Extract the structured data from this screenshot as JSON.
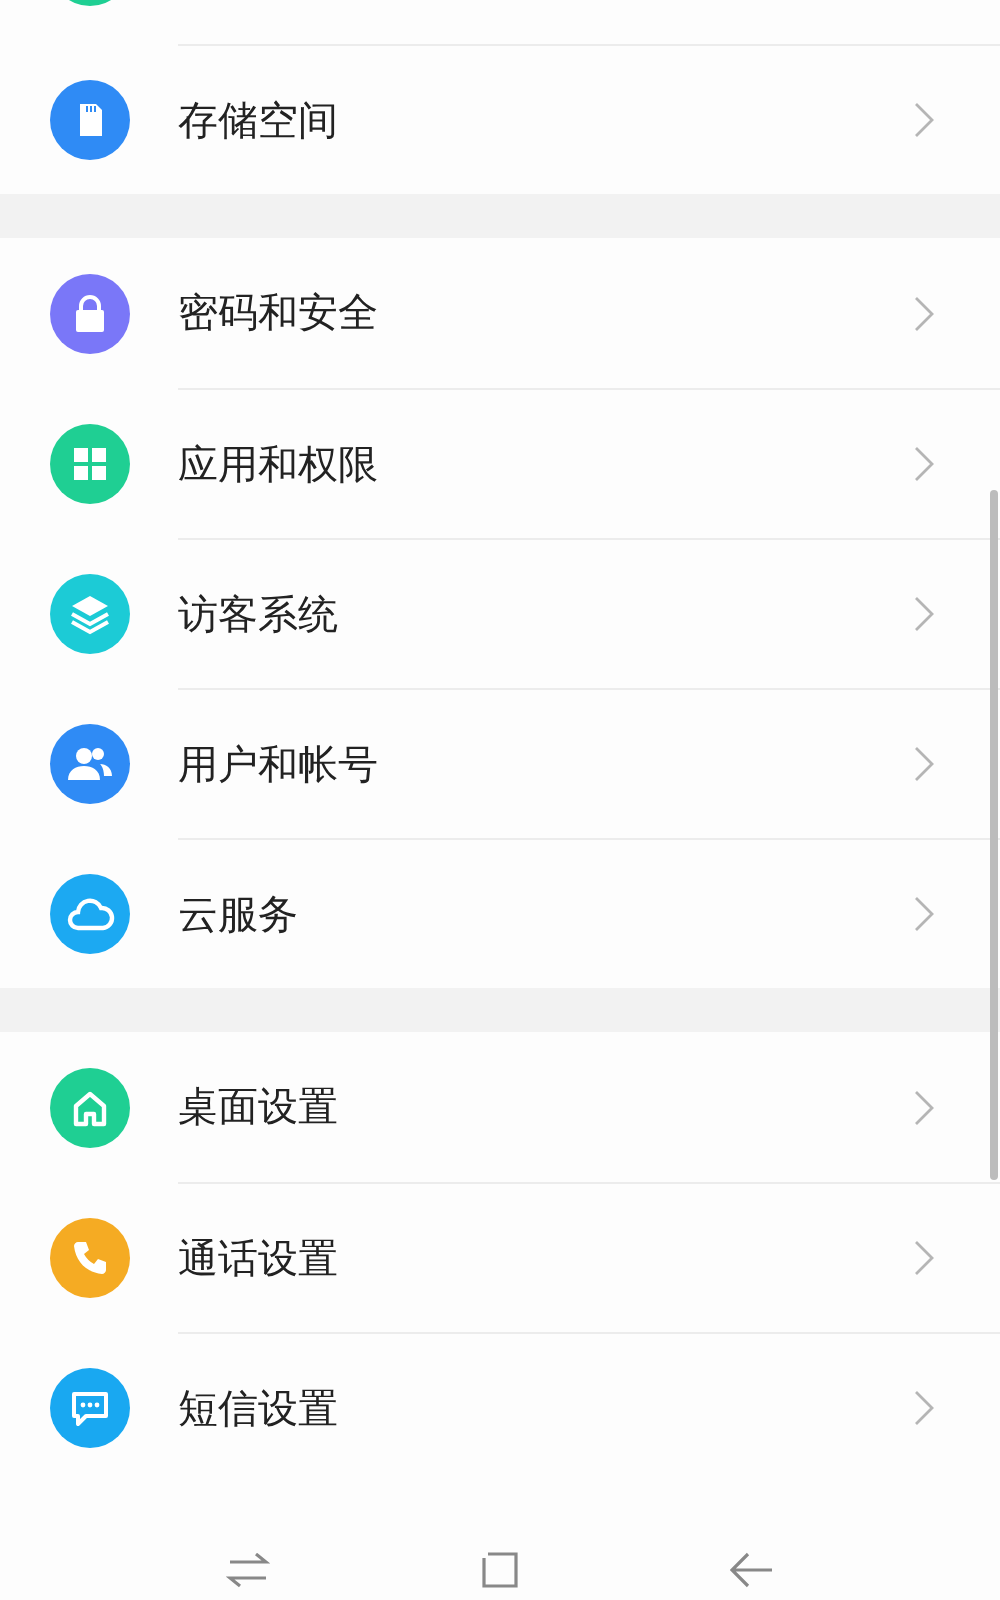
{
  "groups": [
    {
      "items": [
        {
          "kind": "storage",
          "label": "存储空间"
        }
      ]
    },
    {
      "items": [
        {
          "kind": "lock",
          "label": "密码和安全"
        },
        {
          "kind": "apps",
          "label": "应用和权限"
        },
        {
          "kind": "layers",
          "label": "访客系统"
        },
        {
          "kind": "users",
          "label": "用户和帐号"
        },
        {
          "kind": "cloud",
          "label": "云服务"
        }
      ]
    },
    {
      "items": [
        {
          "kind": "home",
          "label": "桌面设置"
        },
        {
          "kind": "phone",
          "label": "通话设置"
        },
        {
          "kind": "message",
          "label": "短信设置"
        }
      ]
    }
  ]
}
